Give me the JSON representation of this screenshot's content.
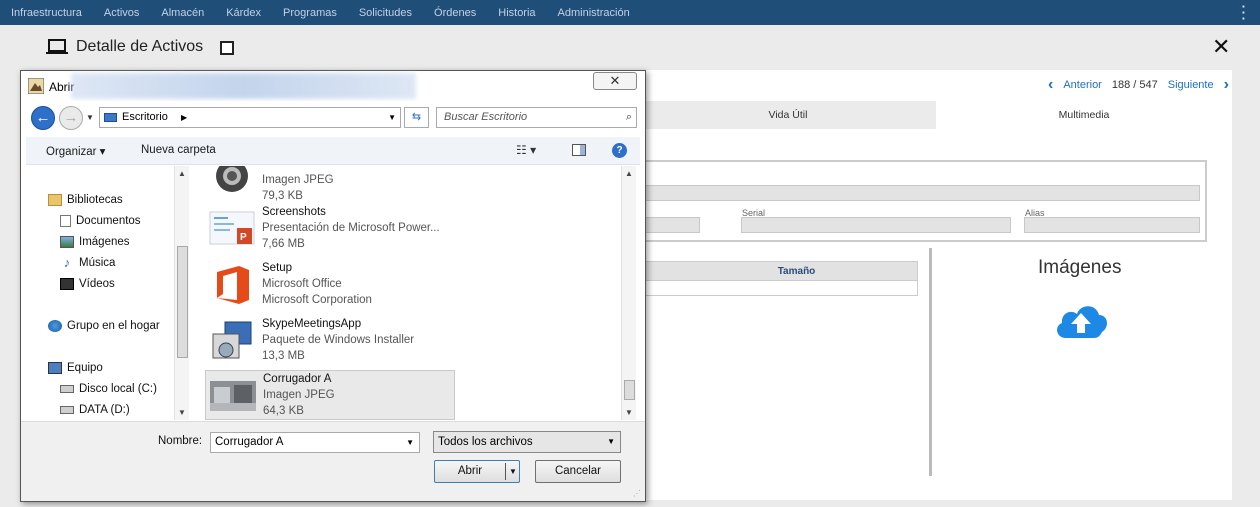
{
  "topnav": {
    "items": [
      "Infraestructura",
      "Activos",
      "Almacén",
      "Kárdex",
      "Programas",
      "Solicitudes",
      "Órdenes",
      "Historia",
      "Administración"
    ],
    "menu_icon": "kebab-vertical-icon"
  },
  "header": {
    "title": "Detalle de Activos",
    "close_icon": "close-icon"
  },
  "record_nav": {
    "prev": "Anterior",
    "position": "188 / 547",
    "next": "Siguiente"
  },
  "tabs": [
    "Vida Útil",
    "Multimedia"
  ],
  "active_tab": "Multimedia",
  "form": {
    "serial_label": "Serial",
    "alias_label": "Alias"
  },
  "table": {
    "header": "Tamaño"
  },
  "media": {
    "title": "Imágenes",
    "upload_icon": "cloud-upload-icon",
    "accent": "#1e88e5"
  },
  "dialog": {
    "title": "Abrir",
    "location": "Escritorio",
    "search_placeholder": "Buscar Escritorio",
    "toolbar": {
      "organize": "Organizar ▾",
      "new_folder": "Nueva carpeta"
    },
    "tree": [
      {
        "label": "Bibliotecas",
        "icon": "libraries-icon"
      },
      {
        "label": "Documentos",
        "icon": "documents-icon"
      },
      {
        "label": "Imágenes",
        "icon": "pictures-icon"
      },
      {
        "label": "Música",
        "icon": "music-icon"
      },
      {
        "label": "Vídeos",
        "icon": "videos-icon"
      },
      {
        "label": "Grupo en el hogar",
        "icon": "homegroup-icon"
      },
      {
        "label": "Equipo",
        "icon": "computer-icon"
      },
      {
        "label": "Disco local (C:)",
        "icon": "drive-icon"
      },
      {
        "label": "DATA (D:)",
        "icon": "drive-icon"
      }
    ],
    "files": [
      {
        "name": "",
        "line1": "Imagen JPEG",
        "line2": "79,3 KB",
        "icon": "jpeg-thumbnail-icon"
      },
      {
        "name": "Screenshots",
        "line1": "Presentación de Microsoft Power...",
        "line2": "7,66 MB",
        "icon": "powerpoint-icon"
      },
      {
        "name": "Setup",
        "line1": "Microsoft Office",
        "line2": "Microsoft Corporation",
        "icon": "office-icon"
      },
      {
        "name": "SkypeMeetingsApp",
        "line1": "Paquete de Windows Installer",
        "line2": "13,3 MB",
        "icon": "installer-icon"
      },
      {
        "name": "Corrugador A",
        "line1": "Imagen JPEG",
        "line2": "64,3 KB",
        "icon": "jpeg-thumbnail-icon"
      }
    ],
    "filename_label": "Nombre:",
    "filename_value": "Corrugador A",
    "filetype_value": "Todos los archivos",
    "open_button": "Abrir",
    "cancel_button": "Cancelar"
  }
}
